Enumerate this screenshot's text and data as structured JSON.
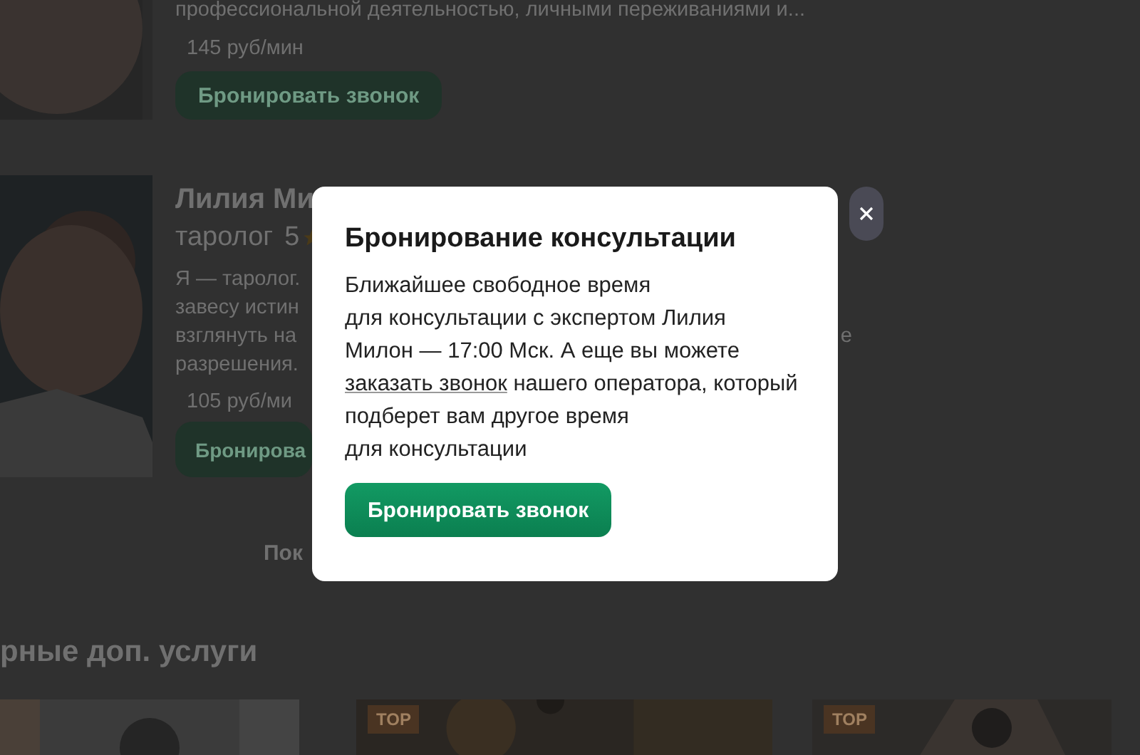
{
  "background": {
    "experts": [
      {
        "description": "профессиональной деятельностью, личными переживаниями и...",
        "price": "145 руб/мин",
        "button": "Бронировать звонок"
      },
      {
        "name": "Лилия Ми",
        "role": "таролог",
        "rating": "5",
        "description": [
          "Я — таролог.",
          "завесу истин",
          "взглянуть на",
          "разрешения."
        ],
        "description_fragment": "е",
        "price": "105 руб/ми",
        "button": "Бронирова"
      }
    ],
    "more_button": "Пок",
    "section_title": "рные доп. услуги",
    "service_cards": [
      {
        "kind": "picture"
      },
      {
        "kind": "picture",
        "badge": "TOP"
      },
      {
        "kind": "picture",
        "badge": "TOP"
      }
    ]
  },
  "modal": {
    "title": "Бронирование консультации",
    "text_before": "Ближайшее свободное время\nдля консультации с экспертом Лилия\nМилон — 17:00 Мск. А еще вы можете\n",
    "link": "заказать звонок",
    "text_after": " нашего оператора, который\nподберет вам другое время\nдля консультации",
    "button": "Бронировать звонок"
  }
}
